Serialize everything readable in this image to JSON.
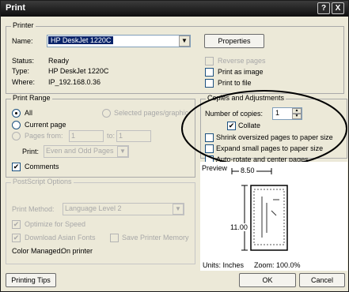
{
  "dialog": {
    "title": "Print",
    "help_glyph": "?",
    "close_glyph": "X"
  },
  "printer": {
    "group_label": "Printer",
    "name_label": "Name:",
    "name_value": "HP DeskJet 1220C",
    "properties_label": "Properties",
    "status_label": "Status:",
    "status_value": "Ready",
    "type_label": "Type:",
    "type_value": "HP DeskJet 1220C",
    "where_label": "Where:",
    "where_value": "IP_192.168.0.36",
    "reverse_pages": "Reverse pages",
    "print_as_image": "Print as image",
    "print_to_file": "Print to file"
  },
  "print_range": {
    "group_label": "Print Range",
    "all": "All",
    "selected_pages": "Selected pages/graphic",
    "current_page": "Current page",
    "pages_from": "Pages from:",
    "from_value": "1",
    "to_label": "to:",
    "to_value": "1",
    "print_label": "Print:",
    "print_value": "Even and Odd Pages",
    "comments": "Comments"
  },
  "copies": {
    "group_label": "Copies and Adjustments",
    "number_label": "Number of copies:",
    "number_value": "1",
    "collate": "Collate",
    "shrink": "Shrink oversized pages to paper size",
    "expand": "Expand small pages to paper size",
    "autorotate": "Auto-rotate and center pages"
  },
  "postscript": {
    "group_label": "PostScript Options",
    "method_label": "Print Method:",
    "method_value": "Language Level 2",
    "optimize": "Optimize for Speed",
    "download_fonts": "Download Asian Fonts",
    "save_memory": "Save Printer Memory",
    "color_managed_label": "Color Managed:",
    "color_managed_value": "On printer"
  },
  "preview": {
    "label": "Preview",
    "width_value": "8.50",
    "height_value": "11.00",
    "units": "Units: Inches",
    "zoom": "Zoom: 100.0%"
  },
  "footer": {
    "tips": "Printing Tips",
    "ok": "OK",
    "cancel": "Cancel"
  },
  "icons": {
    "check": "✔",
    "dropdown": "▼",
    "spin_up": "▲",
    "spin_down": "▼"
  },
  "colors": {
    "title_bg": "#1a1a1a",
    "dialog_bg": "#ece9d8",
    "selection": "#0a246a",
    "annotation": "#000000"
  }
}
